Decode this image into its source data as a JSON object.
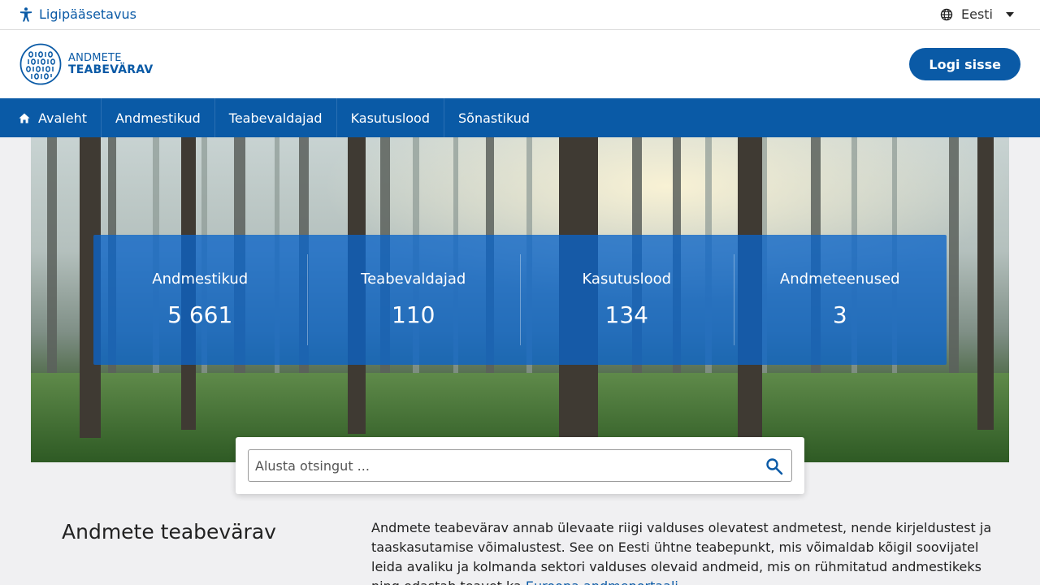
{
  "utility": {
    "accessibility_label": "Ligipääsetavus",
    "language_label": "Eesti"
  },
  "header": {
    "logo_line1": "ANDMETE",
    "logo_line2": "TEABEVÄRAV",
    "login_label": "Logi sisse"
  },
  "nav": {
    "items": [
      {
        "label": "Avaleht",
        "icon": "home-icon"
      },
      {
        "label": "Andmestikud"
      },
      {
        "label": "Teabevaldajad"
      },
      {
        "label": "Kasutuslood"
      },
      {
        "label": "Sõnastikud"
      }
    ]
  },
  "stats": [
    {
      "label": "Andmestikud",
      "value": "5 661"
    },
    {
      "label": "Teabevaldajad",
      "value": "110"
    },
    {
      "label": "Kasutuslood",
      "value": "134"
    },
    {
      "label": "Andmeteenused",
      "value": "3"
    }
  ],
  "search": {
    "placeholder": "Alusta otsingut ..."
  },
  "intro": {
    "title": "Andmete teabevärav",
    "text": "Andmete teabevärav annab ülevaate riigi valduses olevatest andmetest, nende kirjeldustest ja taaskasutamise võimalustest. See on Eesti ühtne teabepunkt, mis võimaldab kõigil soovijatel leida avaliku ja kolmanda sektori valduses olevaid andmeid, mis on rühmitatud andmestikeks ning edastab teavet ka",
    "link_text": "Euroopa andmeportaali"
  },
  "colors": {
    "brand": "#0a5aa6",
    "stats_overlay": "rgba(10,100,200,0.78)"
  }
}
